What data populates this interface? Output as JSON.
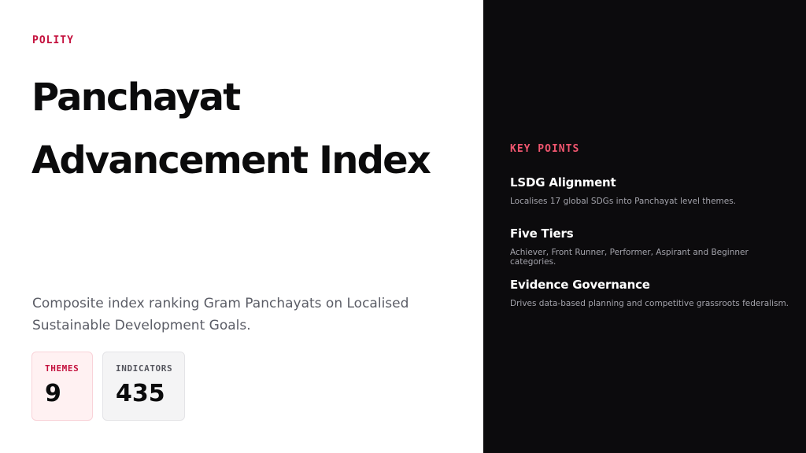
{
  "eyebrow": "POLITY",
  "title_lines": [
    "Panchayat",
    "Advancement Index"
  ],
  "summary": "Composite index ranking Gram Panchayats on Localised Sustainable Development Goals.",
  "stats": [
    {
      "label": "THEMES",
      "value": "9"
    },
    {
      "label": "INDICATORS",
      "value": "435"
    }
  ],
  "key_points": {
    "heading": "KEY POINTS",
    "items": [
      {
        "title": "LSDG Alignment",
        "desc": "Localises 17 global SDGs into Panchayat level themes."
      },
      {
        "title": "Five Tiers",
        "desc": "Achiever, Front Runner, Performer, Aspirant and Beginner categories."
      },
      {
        "title": "Evidence Governance",
        "desc": "Drives data-based planning and competitive grassroots federalism."
      }
    ]
  },
  "colors": {
    "accent": "#c4103d",
    "accent_light": "#f0566f",
    "dark_panel": "#0c0b0d"
  }
}
